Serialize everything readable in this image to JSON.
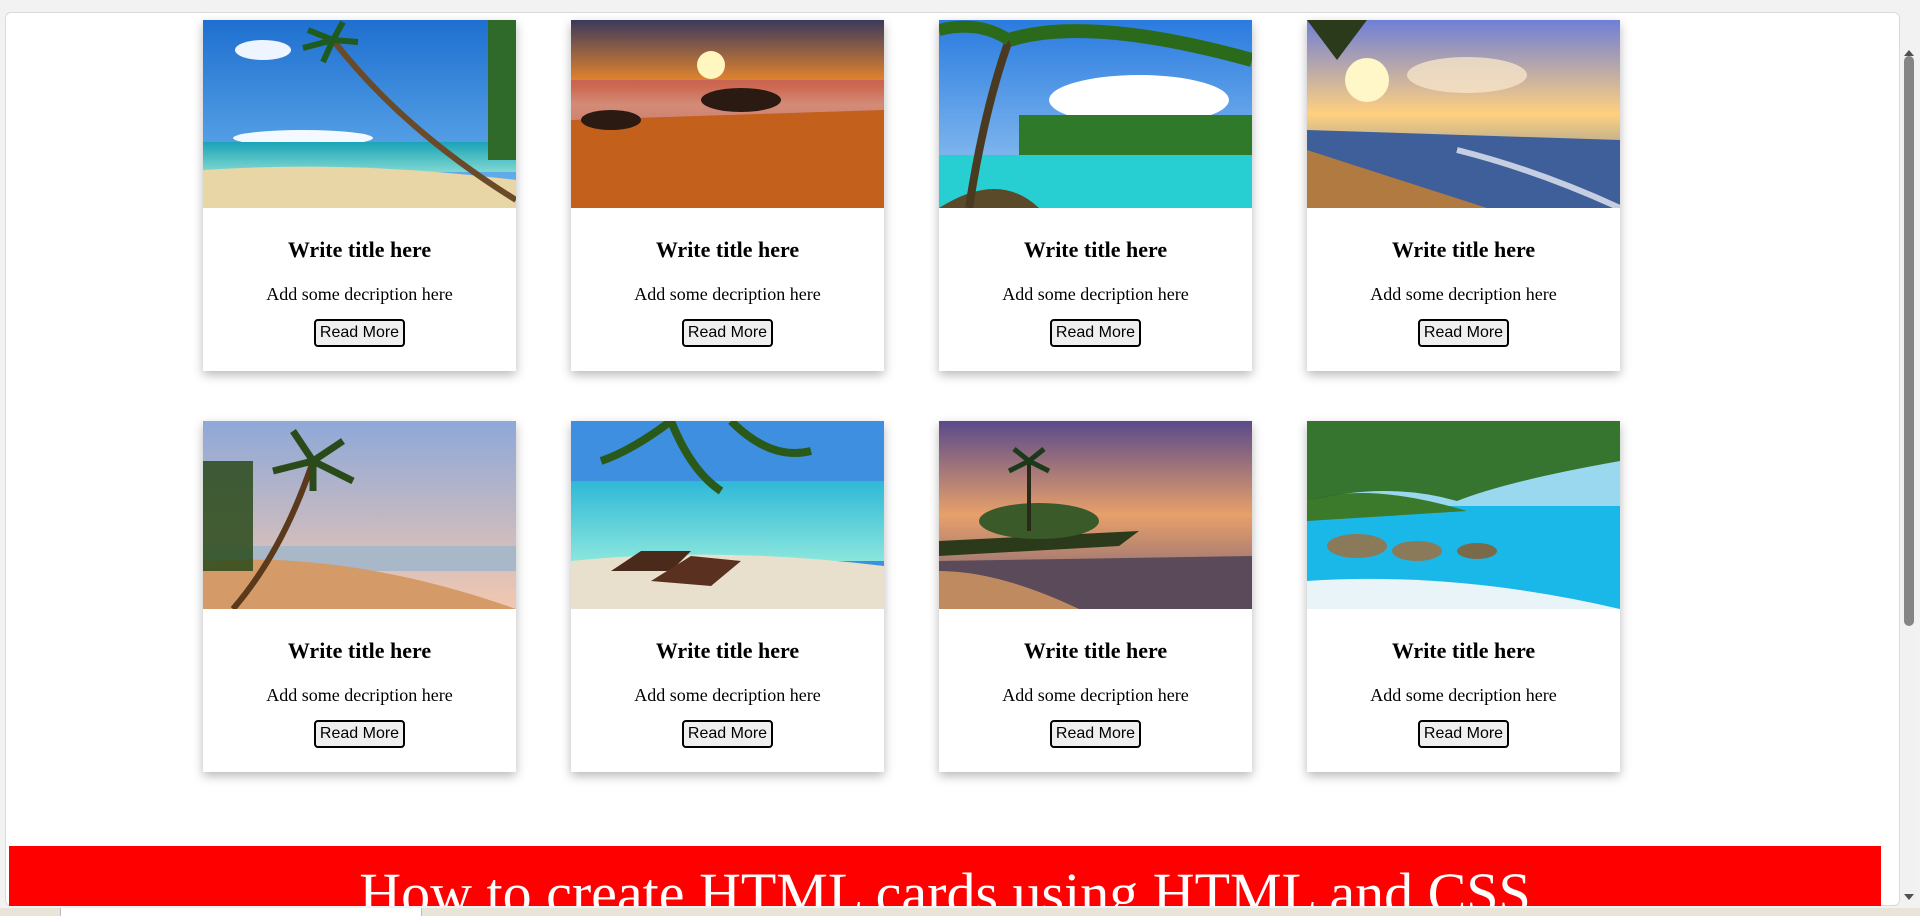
{
  "cards": [
    {
      "title": "Write title here",
      "description": "Add some decription here",
      "button_label": "Read More",
      "image": "beach-palm-leaning-scene"
    },
    {
      "title": "Write title here",
      "description": "Add some decription here",
      "button_label": "Read More",
      "image": "sunset-beach-rocks-scene"
    },
    {
      "title": "Write title here",
      "description": "Add some decription here",
      "button_label": "Read More",
      "image": "tropical-lagoon-palms-scene"
    },
    {
      "title": "Write title here",
      "description": "Add some decription here",
      "button_label": "Read More",
      "image": "sunrise-shoreline-scene"
    },
    {
      "title": "Write title here",
      "description": "Add some decription here",
      "button_label": "Read More",
      "image": "palm-beach-dusk-scene"
    },
    {
      "title": "Write title here",
      "description": "Add some decription here",
      "button_label": "Read More",
      "image": "beach-loungers-scene"
    },
    {
      "title": "Write title here",
      "description": "Add some decription here",
      "button_label": "Read More",
      "image": "island-purple-sunset-scene"
    },
    {
      "title": "Write title here",
      "description": "Add some decription here",
      "button_label": "Read More",
      "image": "rocky-cove-turquoise-scene"
    }
  ],
  "banner": {
    "text": "How to create HTML cards using HTML and CSS"
  },
  "colors": {
    "banner": "#ff0000",
    "card_shadow": "rgba(0,0,0,0.28)"
  }
}
